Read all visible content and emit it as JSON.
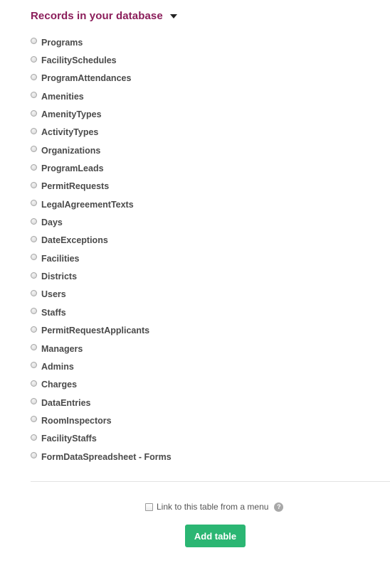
{
  "header": {
    "title": "Records in your database",
    "toggle_icon": "caret-down-icon"
  },
  "records": [
    {
      "label": "Programs"
    },
    {
      "label": "FacilitySchedules"
    },
    {
      "label": "ProgramAttendances"
    },
    {
      "label": "Amenities"
    },
    {
      "label": "AmenityTypes"
    },
    {
      "label": "ActivityTypes"
    },
    {
      "label": "Organizations"
    },
    {
      "label": "ProgramLeads"
    },
    {
      "label": "PermitRequests"
    },
    {
      "label": "LegalAgreementTexts"
    },
    {
      "label": "Days"
    },
    {
      "label": "DateExceptions"
    },
    {
      "label": "Facilities"
    },
    {
      "label": "Districts"
    },
    {
      "label": "Users"
    },
    {
      "label": "Staffs"
    },
    {
      "label": "PermitRequestApplicants"
    },
    {
      "label": "Managers"
    },
    {
      "label": "Admins"
    },
    {
      "label": "Charges"
    },
    {
      "label": "DataEntries"
    },
    {
      "label": "RoomInspectors"
    },
    {
      "label": "FacilityStaffs"
    },
    {
      "label": "FormDataSpreadsheet - Forms"
    }
  ],
  "link_option": {
    "label": "Link to this table from a menu",
    "checked": false,
    "help_icon": "question-mark-icon",
    "help_glyph": "?"
  },
  "actions": {
    "add_label": "Add table",
    "add_color": "#2bb673"
  },
  "colors": {
    "header": "#8b1d5a",
    "text": "#4a4a4a"
  }
}
